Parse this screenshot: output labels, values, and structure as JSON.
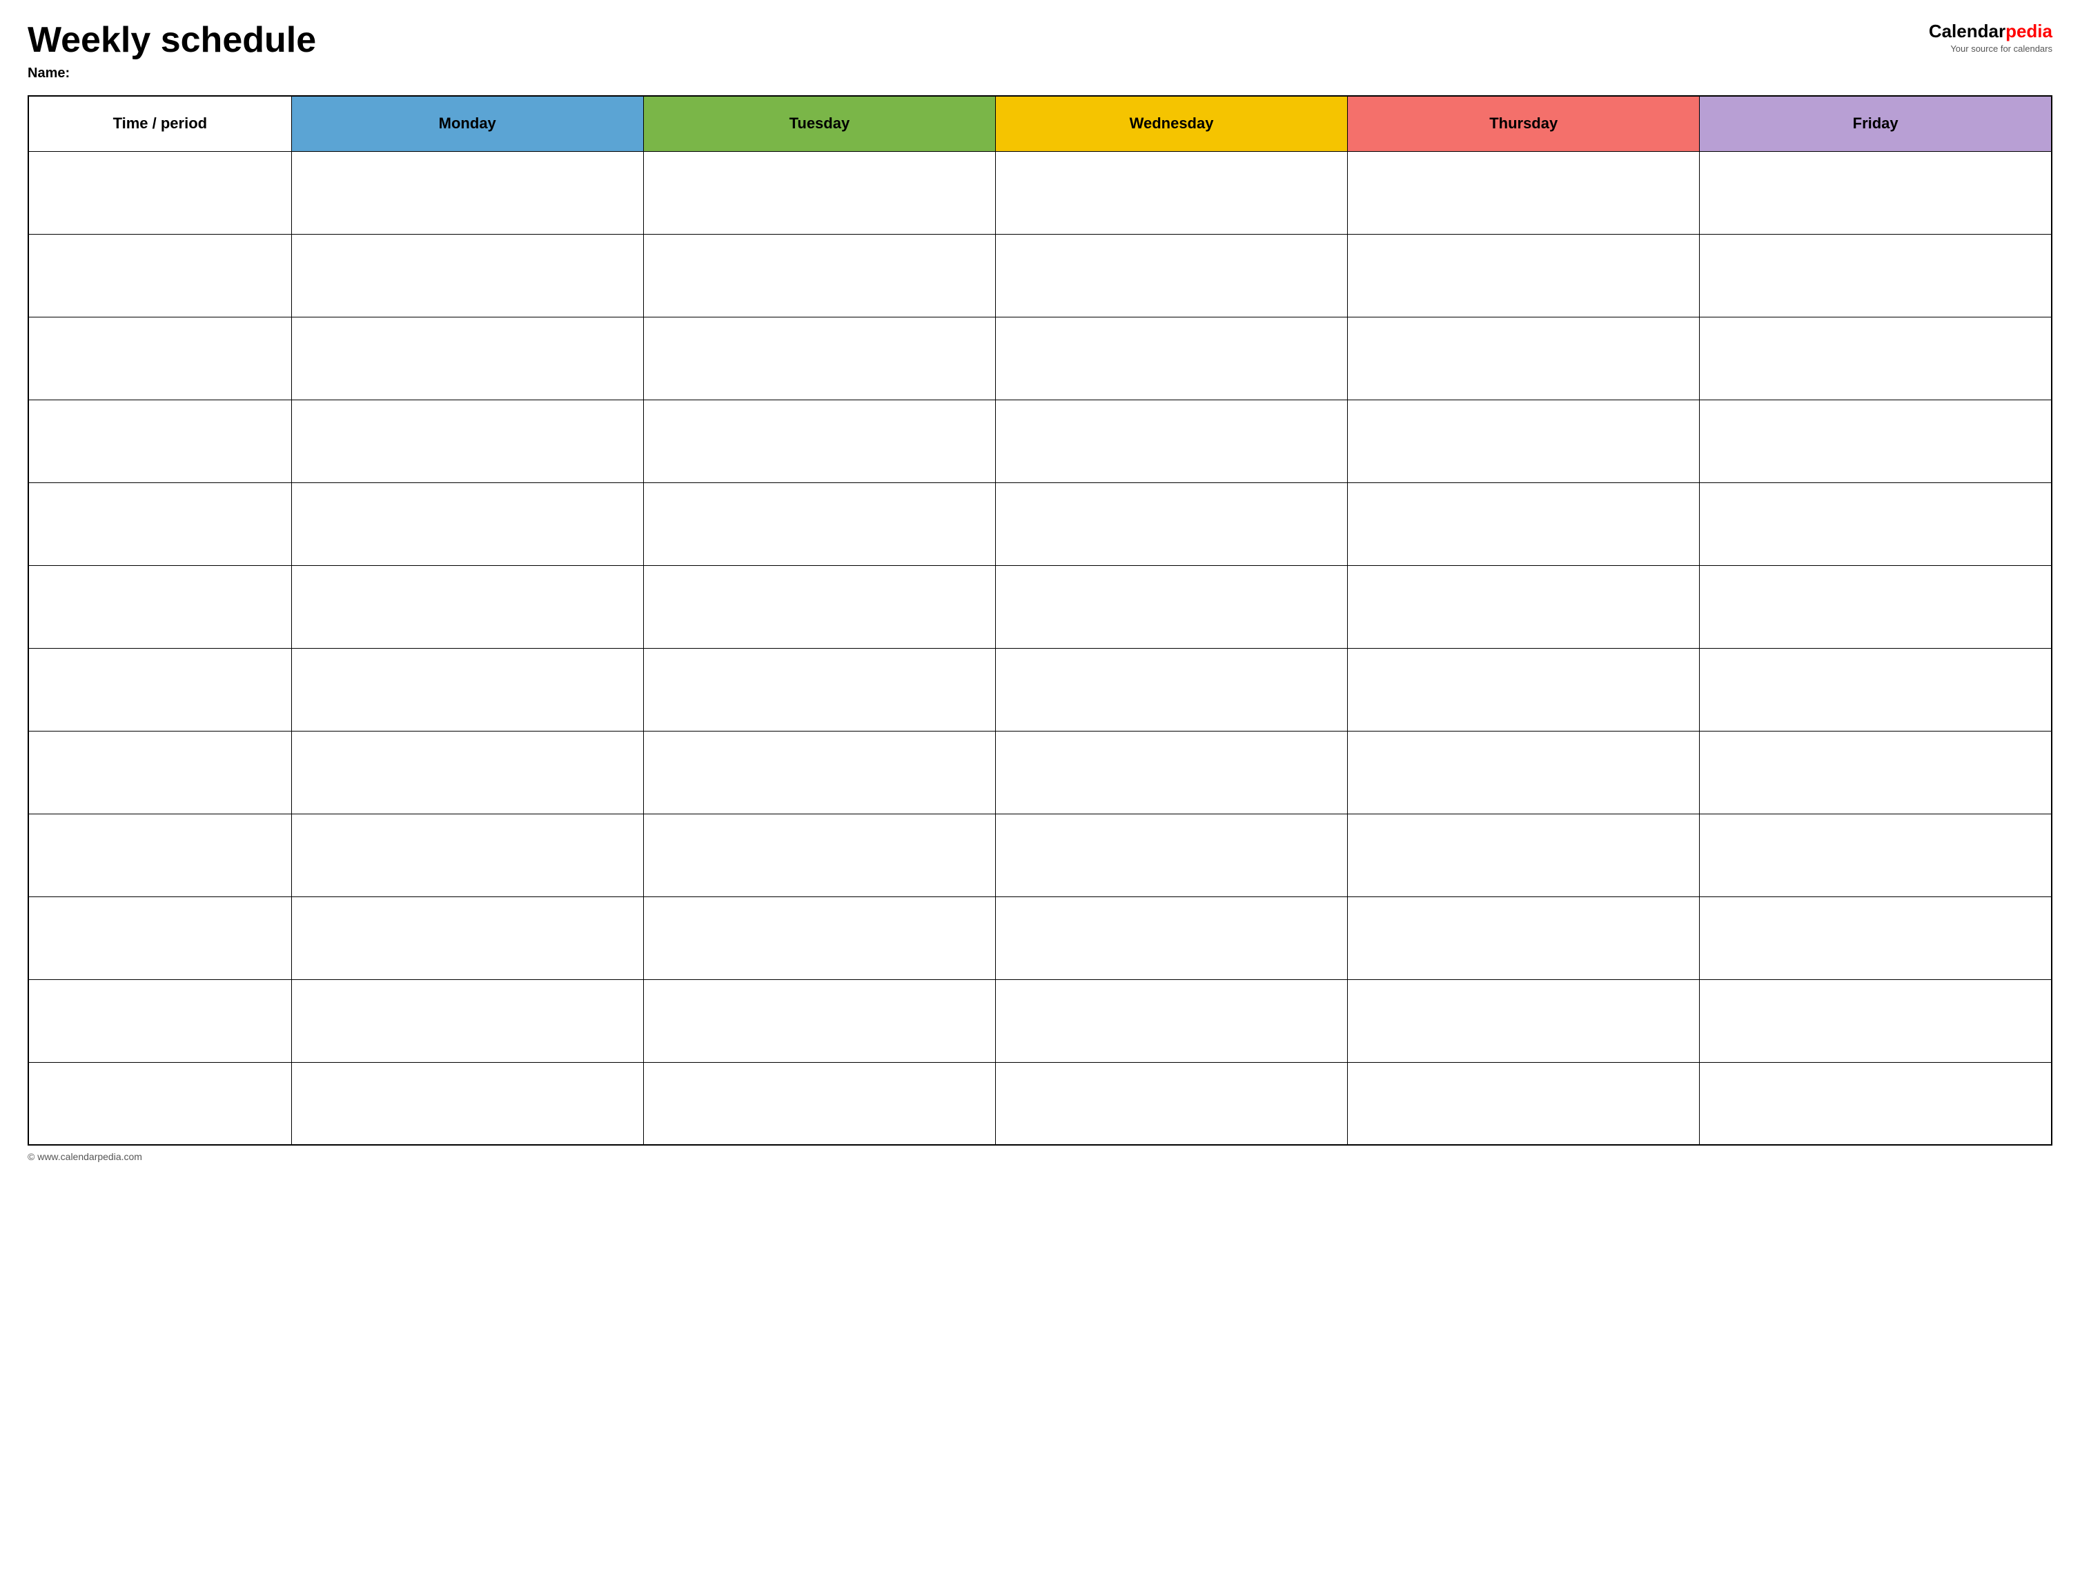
{
  "header": {
    "title": "Weekly schedule",
    "name_label": "Name:",
    "logo": {
      "calendar_text": "Calendar",
      "pedia_text": "pedia",
      "tagline": "Your source for calendars"
    }
  },
  "table": {
    "columns": [
      {
        "id": "time",
        "label": "Time / period",
        "color": "#ffffff"
      },
      {
        "id": "monday",
        "label": "Monday",
        "color": "#5ba4d4"
      },
      {
        "id": "tuesday",
        "label": "Tuesday",
        "color": "#7ab648"
      },
      {
        "id": "wednesday",
        "label": "Wednesday",
        "color": "#f5c400"
      },
      {
        "id": "thursday",
        "label": "Thursday",
        "color": "#f4706b"
      },
      {
        "id": "friday",
        "label": "Friday",
        "color": "#b89fd4"
      }
    ],
    "rows": 12
  },
  "footer": {
    "copyright": "© www.calendarpedia.com"
  }
}
